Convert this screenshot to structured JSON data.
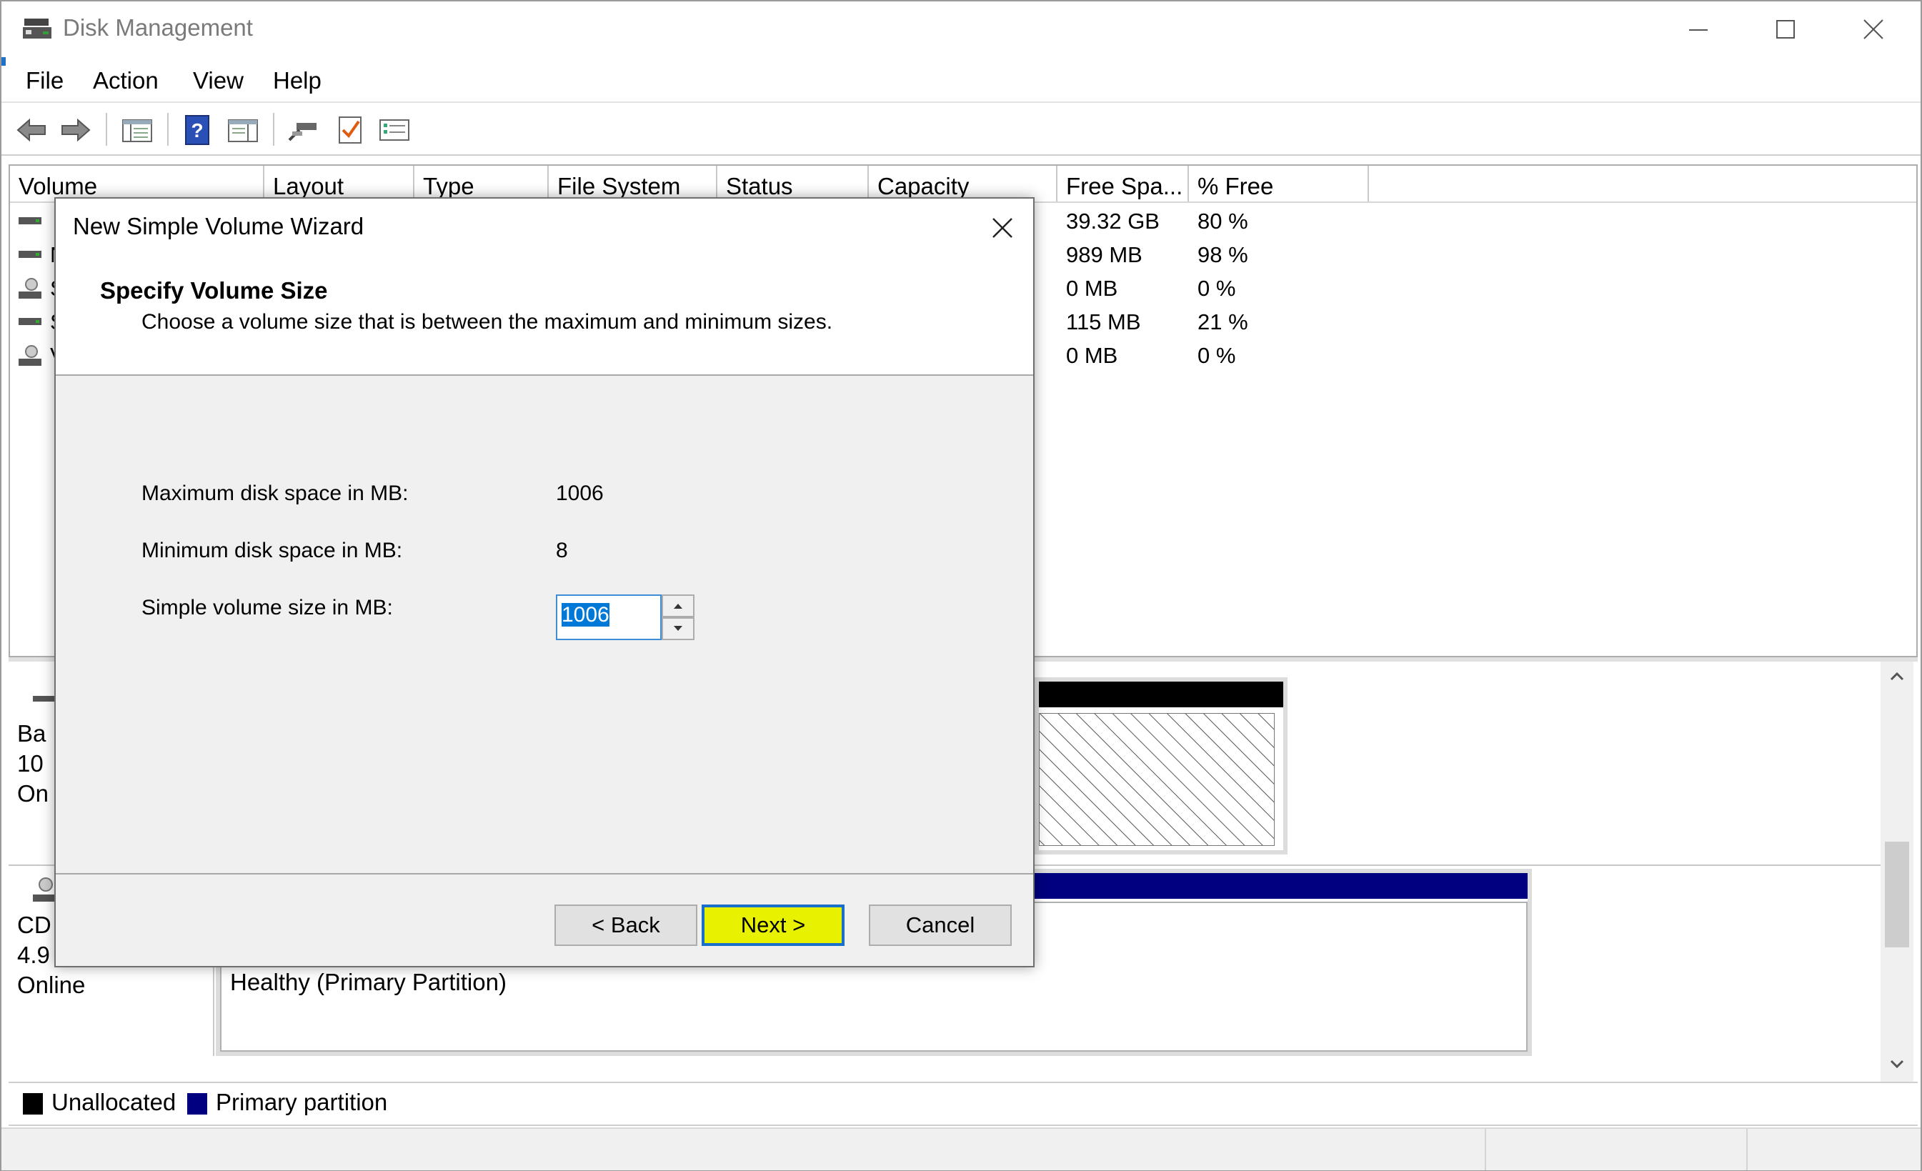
{
  "window": {
    "title": "Disk Management",
    "minimize": "minimize",
    "maximize": "maximize",
    "close": "close"
  },
  "menu": [
    "File",
    "Action",
    "View",
    "Help"
  ],
  "toolbar": {
    "icons": [
      "back-arrow-icon",
      "forward-arrow-icon",
      "console-tree-icon",
      "help-icon",
      "properties-icon",
      "connect-disk-icon",
      "check-icon",
      "list-icon"
    ]
  },
  "table": {
    "columns": [
      "Volume",
      "Layout",
      "Type",
      "File System",
      "Status",
      "Capacity",
      "Free Spa...",
      "% Free"
    ],
    "rows": [
      {
        "free": "39.32 GB",
        "pct": "80 %"
      },
      {
        "free": "989 MB",
        "pct": "98 %"
      },
      {
        "free": "0 MB",
        "pct": "0 %"
      },
      {
        "free": "115 MB",
        "pct": "21 %"
      },
      {
        "free": "0 MB",
        "pct": "0 %"
      }
    ],
    "row_fragments": [
      "",
      "N",
      "S",
      "S",
      "V"
    ]
  },
  "disks": {
    "disk1": {
      "line1": "Ba",
      "line2": "10",
      "line3": "On"
    },
    "disk2": {
      "line1": "CD",
      "line2": "4.9",
      "line3": "Online",
      "partition_status": "Healthy (Primary Partition)"
    }
  },
  "legend": [
    {
      "label": "Unallocated",
      "color": "#000000"
    },
    {
      "label": "Primary partition",
      "color": "#000080"
    }
  ],
  "dialog": {
    "title": "New Simple Volume Wizard",
    "heading": "Specify Volume Size",
    "subheading": "Choose a volume size that is between the maximum and minimum sizes.",
    "max_label": "Maximum disk space in MB:",
    "max_value": "1006",
    "min_label": "Minimum disk space in MB:",
    "min_value": "8",
    "size_label": "Simple volume size in MB:",
    "size_value": "1006",
    "back": "< Back",
    "next": "Next >",
    "cancel": "Cancel"
  }
}
